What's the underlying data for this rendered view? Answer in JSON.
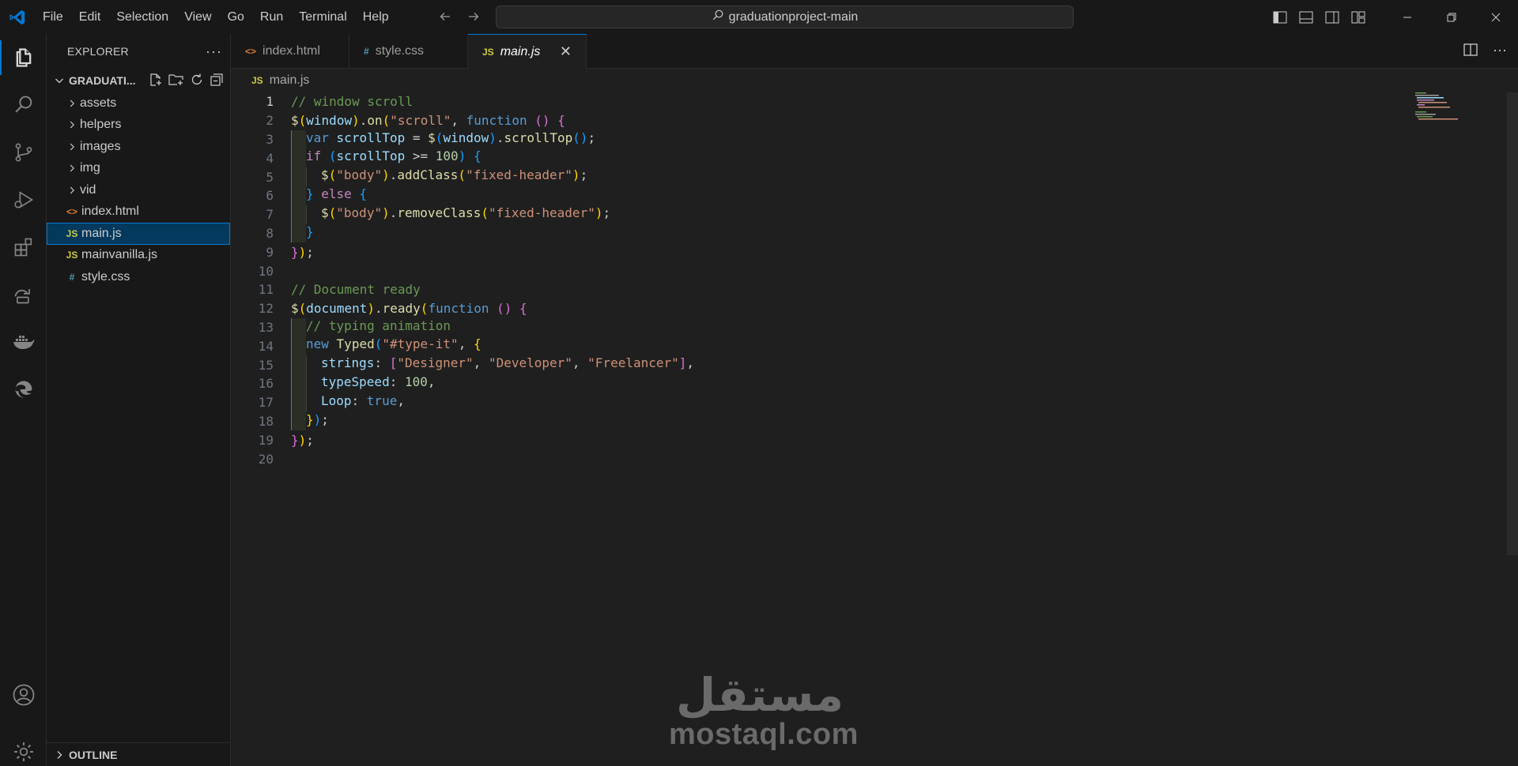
{
  "titlebar": {
    "menu": [
      "File",
      "Edit",
      "Selection",
      "View",
      "Go",
      "Run",
      "Terminal",
      "Help"
    ],
    "search_text": "graduationproject-main"
  },
  "activitybar": {
    "items": [
      "explorer-icon",
      "search-icon",
      "source-control-icon",
      "run-debug-icon",
      "extensions-icon",
      "remote-explorer-icon",
      "docker-icon",
      "edge-icon"
    ],
    "bottom": [
      "account-icon",
      "settings-icon"
    ]
  },
  "sidebar": {
    "title": "EXPLORER",
    "more": "···",
    "project": "GRADUATI...",
    "tree": [
      {
        "type": "folder",
        "label": "assets"
      },
      {
        "type": "folder",
        "label": "helpers"
      },
      {
        "type": "folder",
        "label": "images"
      },
      {
        "type": "folder",
        "label": "img"
      },
      {
        "type": "folder",
        "label": "vid"
      },
      {
        "type": "html",
        "label": "index.html"
      },
      {
        "type": "js",
        "label": "main.js",
        "selected": true
      },
      {
        "type": "js",
        "label": "mainvanilla.js"
      },
      {
        "type": "css",
        "label": "style.css"
      }
    ],
    "outline": "OUTLINE"
  },
  "editor": {
    "tabs": [
      {
        "label": "index.html",
        "icon": "<>",
        "type": "html"
      },
      {
        "label": "style.css",
        "icon": "#",
        "type": "css"
      },
      {
        "label": "main.js",
        "icon": "JS",
        "type": "js",
        "active": true
      }
    ],
    "close_glyph": "✕",
    "breadcrumb_icon": "JS",
    "breadcrumb": "main.js",
    "line_numbers": [
      "1",
      "2",
      "3",
      "4",
      "5",
      "6",
      "7",
      "8",
      "9",
      "10",
      "11",
      "12",
      "13",
      "14",
      "15",
      "16",
      "17",
      "18",
      "19",
      "20"
    ]
  },
  "watermark": {
    "arabic": "مستقل",
    "latin": "mostaql.com"
  },
  "colors": {
    "accent": "#0078d4",
    "js_icon": "#cbcb41",
    "html_icon": "#e37933",
    "css_icon": "#519aba"
  }
}
